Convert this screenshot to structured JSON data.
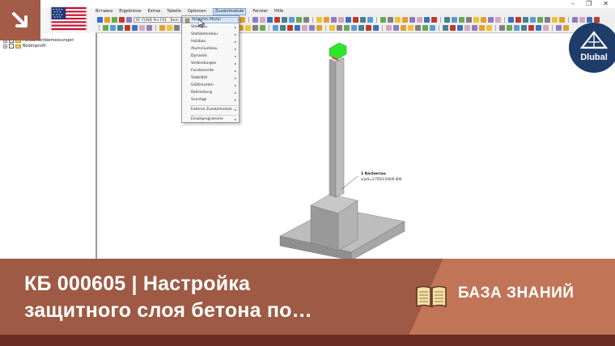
{
  "window": {
    "controls": [
      "–",
      "❐",
      "✕"
    ]
  },
  "menubar": {
    "items": [
      "Вставка",
      "Ergebnisse",
      "Extras",
      "Tabelle",
      "Optionen",
      "Zusatzmodule",
      "Fenster",
      "Hilfe"
    ],
    "active_index": 5
  },
  "toolbar": {
    "module_select": "RF-FUND Pro FA1 - Bem"
  },
  "navigator": {
    "items": [
      {
        "label": "Fundamentbemessungen",
        "checked": true
      },
      {
        "label": "Bodenprofil",
        "checked": false
      }
    ]
  },
  "dropdown": {
    "items": [
      {
        "label": "Aktuelles Modul",
        "submenu": false,
        "highlight": true
      },
      {
        "label": "Stahlbau",
        "submenu": true
      },
      {
        "label": "Stahlbetonbau",
        "submenu": true
      },
      {
        "label": "Holzbau",
        "submenu": true
      },
      {
        "label": "Aluminiumbau",
        "submenu": true
      },
      {
        "label": "Dynamik",
        "submenu": true
      },
      {
        "label": "Verbindungen",
        "submenu": true
      },
      {
        "label": "Fundamente",
        "submenu": true
      },
      {
        "label": "Stabilität",
        "submenu": true
      },
      {
        "label": "Glättmasten",
        "submenu": true
      },
      {
        "label": "Rohrleitung",
        "submenu": true
      },
      {
        "label": "Sonstige",
        "submenu": true
      },
      {
        "label": "Externe Zusatzmodule",
        "submenu": true
      },
      {
        "label": "Einzelprogramme",
        "submenu": true
      }
    ],
    "submenu_arrow": "▸"
  },
  "viewport": {
    "annotation_title": "1 Köcherrau",
    "annotation_value": "x/y/d=3.750/3.500/0.400"
  },
  "logo": {
    "brand": "Dlubal",
    "color": "#1e3d6b"
  },
  "banner": {
    "title_line1": "КБ 000605 | Настройка",
    "title_line2": "защитного слоя бетона по…",
    "label": "БАЗА ЗНАНИЙ",
    "accent_dark": "#9e5a44",
    "accent_light": "#c27456"
  },
  "icons": {
    "corner": "arrow-down-right-icon",
    "flag": "us-flag-icon",
    "book": "open-book-icon"
  }
}
